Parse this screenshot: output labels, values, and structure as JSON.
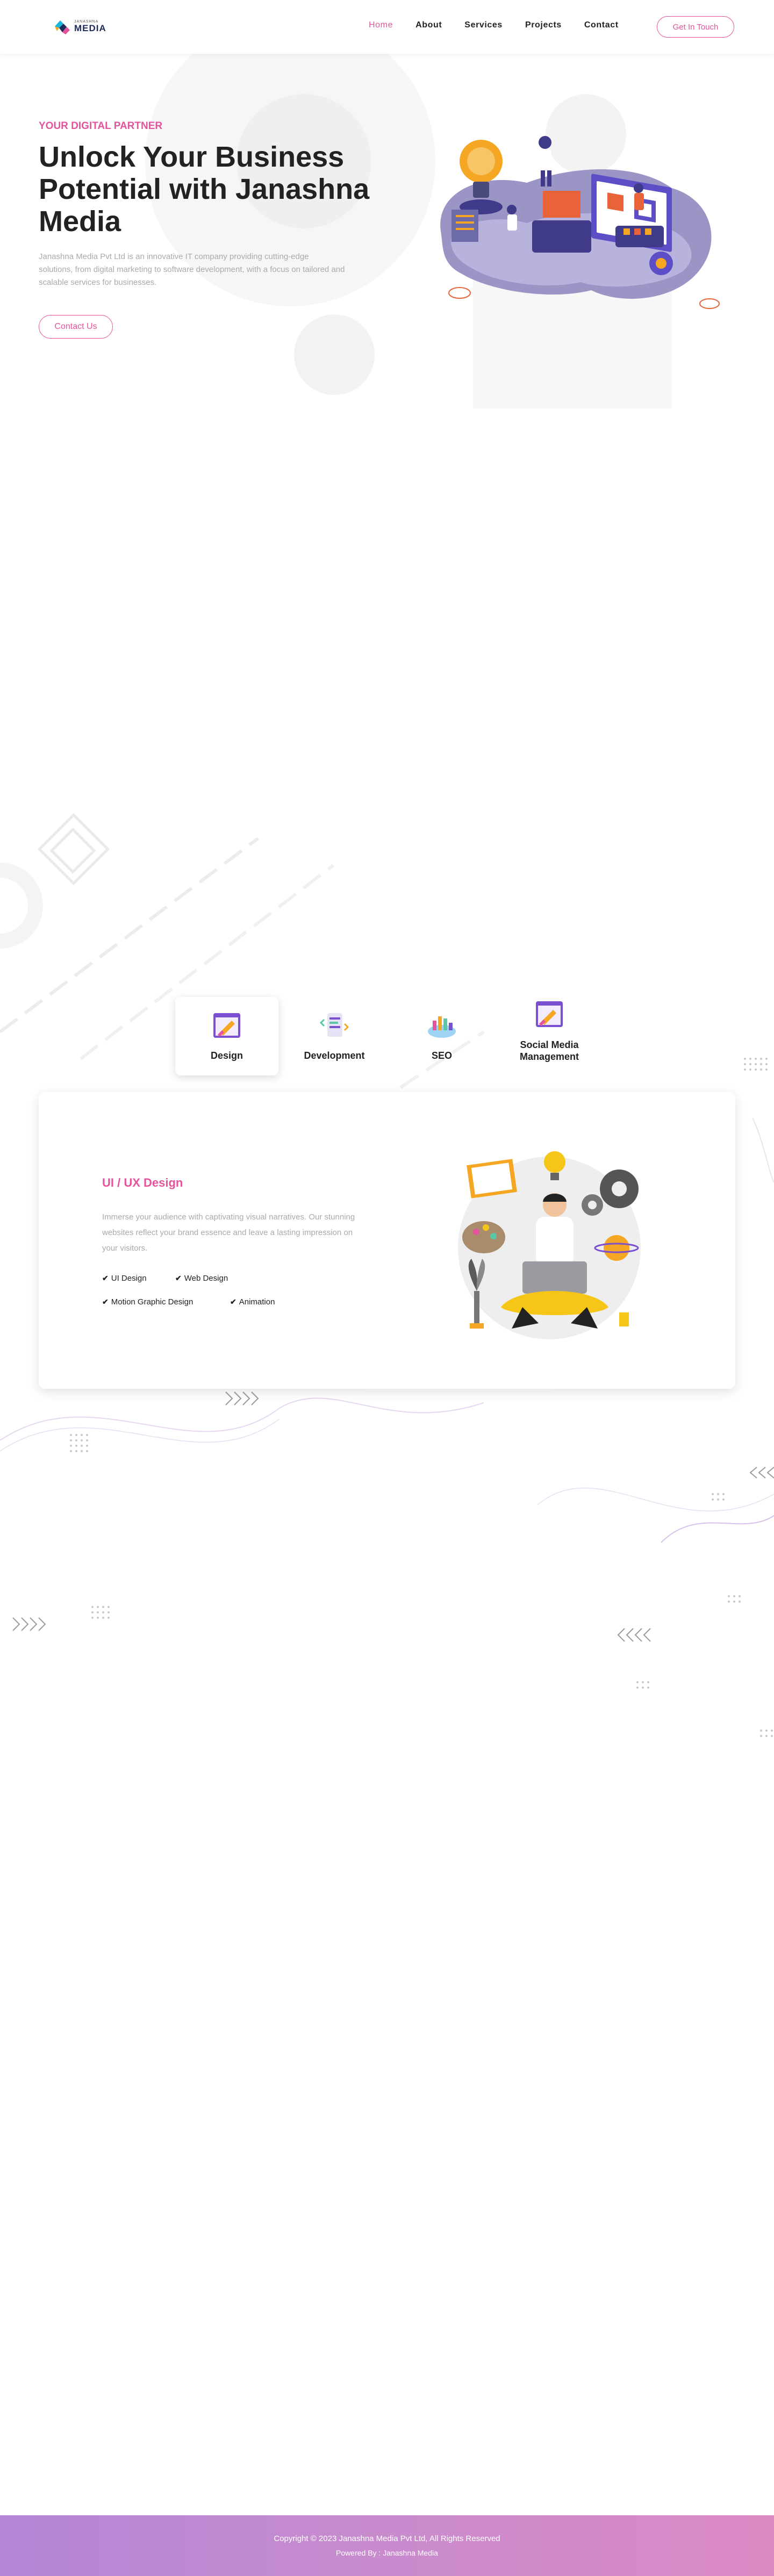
{
  "brand": {
    "logo_small": "JANASHNA",
    "logo_big": "MEDIA"
  },
  "nav": {
    "links": [
      "Home",
      "About",
      "Services",
      "Projects",
      "Contact"
    ],
    "active": "Home",
    "cta": "Get In Touch"
  },
  "hero": {
    "kicker": "YOUR DIGITAL PARTNER",
    "title": "Unlock Your Business Potential with Janashna Media",
    "description": "Janashna Media Pvt Ltd is an innovative IT company providing cutting-edge solutions, from digital marketing to software development, with a focus on tailored and scalable services for businesses.",
    "button": "Contact Us"
  },
  "services": {
    "tabs": [
      {
        "label": "Design",
        "icon": "design-icon"
      },
      {
        "label": "Development",
        "icon": "development-icon"
      },
      {
        "label": "SEO",
        "icon": "seo-icon"
      },
      {
        "label": "Social Media Management",
        "icon": "social-media-icon"
      }
    ],
    "active_tab": "Design",
    "panel": {
      "title": "UI / UX Design",
      "description": "Immerse your audience with captivating visual narratives. Our stunning websites reflect your brand essence and leave a lasting impression on your visitors.",
      "features": [
        "UI Design",
        "Web Design",
        "Motion Graphic Design",
        "Animation"
      ]
    }
  },
  "footer": {
    "copyright": "Copyright © 2023 Janashna Media Pvt Ltd, All Rights Reserved",
    "powered": "Powered By : Janashna Media"
  },
  "colors": {
    "accent": "#e5539c",
    "footer_gradient_start": "#b386d6",
    "footer_gradient_end": "#dc8ac4"
  }
}
